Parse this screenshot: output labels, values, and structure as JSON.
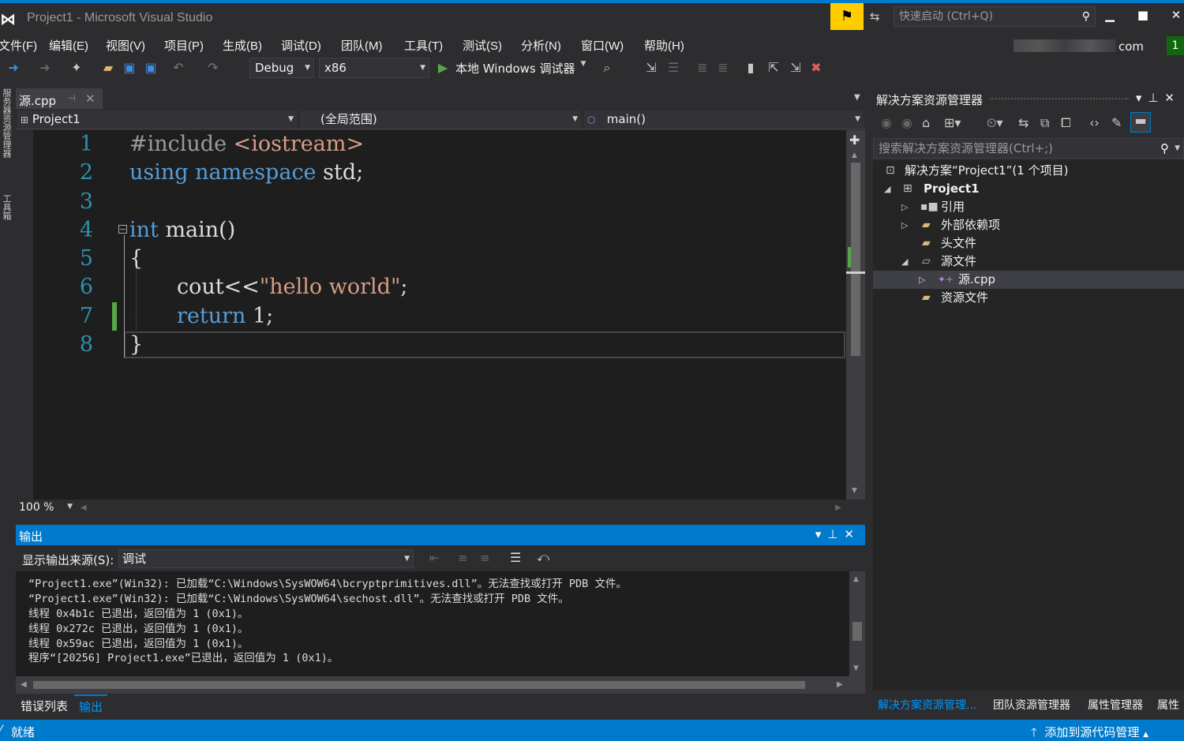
{
  "window": {
    "title": "Project1 - Microsoft Visual Studio",
    "quick_launch_placeholder": "快速启动 (Ctrl+Q)",
    "account_suffix": "com",
    "notification_count": "1"
  },
  "menu": [
    "文件(F)",
    "编辑(E)",
    "视图(V)",
    "项目(P)",
    "生成(B)",
    "调试(D)",
    "团队(M)",
    "工具(T)",
    "测试(S)",
    "分析(N)",
    "窗口(W)",
    "帮助(H)"
  ],
  "toolbar": {
    "config": "Debug",
    "platform": "x86",
    "debugger": "本地 Windows 调试器"
  },
  "left_strip": [
    "服务器资源管理器",
    "工具箱"
  ],
  "editor": {
    "tab_label": "源.cpp",
    "nav_project": "Project1",
    "nav_scope": "(全局范围)",
    "nav_member": "main()",
    "zoom": "100 %",
    "lines": [
      "1",
      "2",
      "3",
      "4",
      "5",
      "6",
      "7",
      "8"
    ],
    "code": {
      "l1_pp": "#include ",
      "l1_inc": "<iostream>",
      "l2_kw": "using namespace",
      "l2_rest": " std;",
      "l4_kw": "int",
      "l4_rest": " main()",
      "l5": "{",
      "l6_a": "cout<<",
      "l6_str": "\"hello world\"",
      "l6_b": ";",
      "l7_kw": "return",
      "l7_rest": " 1;",
      "l8": "}"
    }
  },
  "output": {
    "title": "输出",
    "source_label": "显示输出来源(S):",
    "source_value": "调试",
    "lines": [
      "“Project1.exe”(Win32): 已加载“C:\\Windows\\SysWOW64\\bcryptprimitives.dll”。无法查找或打开 PDB 文件。",
      "“Project1.exe”(Win32): 已加载“C:\\Windows\\SysWOW64\\sechost.dll”。无法查找或打开 PDB 文件。",
      "线程 0x4b1c 已退出，返回值为 1 (0x1)。",
      "线程 0x272c 已退出，返回值为 1 (0x1)。",
      "线程 0x59ac 已退出，返回值为 1 (0x1)。",
      "程序“[20256] Project1.exe”已退出，返回值为 1 (0x1)。"
    ]
  },
  "bottom_tabs": [
    "错误列表",
    "输出"
  ],
  "solution_explorer": {
    "title": "解决方案资源管理器",
    "search_placeholder": "搜索解决方案资源管理器(Ctrl+;)",
    "nodes": [
      "解决方案“Project1”(1 个项目)",
      "Project1",
      "引用",
      "外部依赖项",
      "头文件",
      "源文件",
      "源.cpp",
      "资源文件"
    ],
    "tabs": [
      "解决方案资源管理...",
      "团队资源管理器",
      "属性管理器",
      "属性"
    ]
  },
  "status": {
    "left": "就绪",
    "right": "添加到源代码管理"
  },
  "colors": {
    "accent": "#007acc",
    "keyword": "#569cd6",
    "string": "#d69d85",
    "line_number": "#2b91af"
  }
}
